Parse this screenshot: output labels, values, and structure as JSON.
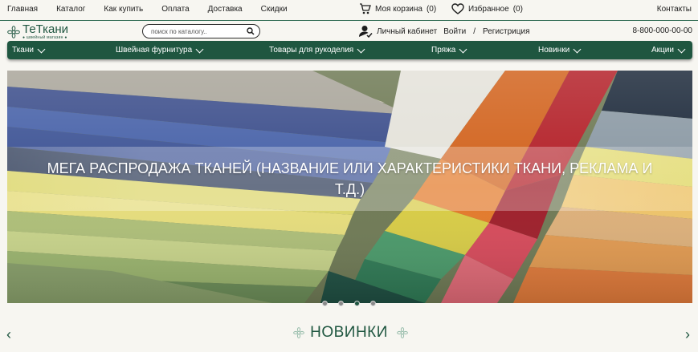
{
  "topnav": {
    "items": [
      "Главная",
      "Каталог",
      "Как купить",
      "Оплата",
      "Доставка",
      "Скидки"
    ]
  },
  "cart": {
    "label": "Моя корзина",
    "count": "(0)"
  },
  "favorites": {
    "label": "Избранное",
    "count": "(0)"
  },
  "contacts_label": "Контакты",
  "logo": {
    "name": "ТеТкани",
    "tagline": "● швейный магазин ●"
  },
  "search": {
    "placeholder": "поиск по каталогу.."
  },
  "account": {
    "cabinet": "Личный кабинет",
    "login": "Войти",
    "separator": "/",
    "register": "Регистриция"
  },
  "phone": "8-800-000-00-00",
  "mainnav": {
    "items": [
      {
        "label": "Ткани"
      },
      {
        "label": "Швейная фурнитура"
      },
      {
        "label": "Товары для рукоделия"
      },
      {
        "label": "Пряжа"
      },
      {
        "label": "Новинки"
      },
      {
        "label": "Акции"
      }
    ]
  },
  "banner": {
    "text": "МЕГА РАСПРОДАЖА ТКАНЕЙ (НАЗВАНИЕ ИЛИ ХАРАКТЕРИСТИКИ ТКАНИ, РЕКЛАМА И Т.Д.)",
    "slides": 4,
    "active_slide": 3
  },
  "section": {
    "title": "НОВИНКИ"
  },
  "colors": {
    "brand": "#1f5640",
    "background": "#f7f6f1"
  }
}
